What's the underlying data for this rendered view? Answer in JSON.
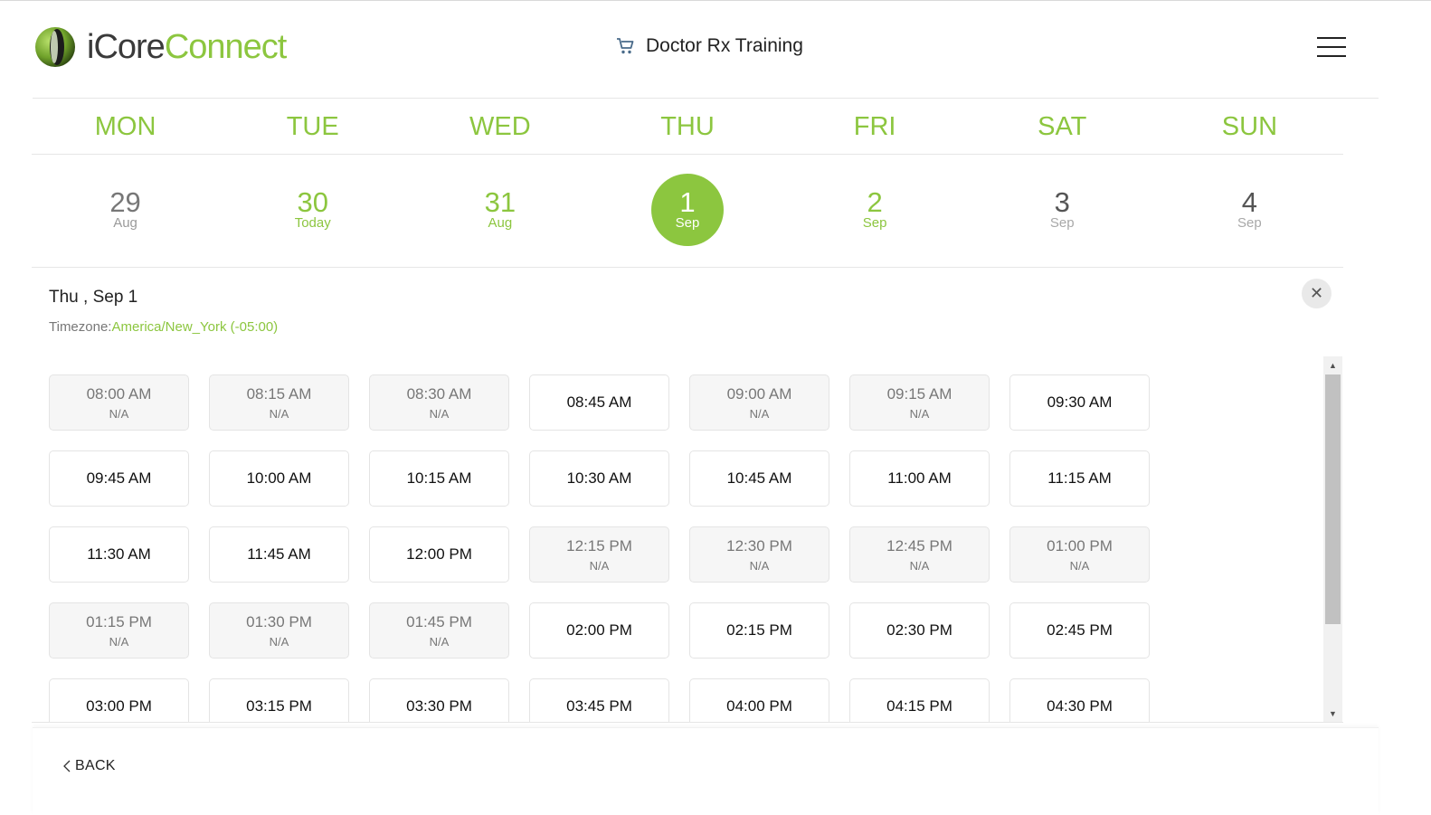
{
  "brand": {
    "name_part1": "iCore",
    "name_part2": "Connect",
    "green": "#8cc63f"
  },
  "header": {
    "title": "Doctor Rx Training",
    "cart_icon": "cart-icon",
    "menu_icon": "hamburger-icon"
  },
  "week": {
    "days": [
      "MON",
      "TUE",
      "WED",
      "THU",
      "FRI",
      "SAT",
      "SUN"
    ],
    "dates": [
      {
        "num": "29",
        "sub": "Aug",
        "state": "past"
      },
      {
        "num": "30",
        "sub": "Today",
        "state": "green"
      },
      {
        "num": "31",
        "sub": "Aug",
        "state": "green"
      },
      {
        "num": "1",
        "sub": "Sep",
        "state": "selected"
      },
      {
        "num": "2",
        "sub": "Sep",
        "state": "green"
      },
      {
        "num": "3",
        "sub": "Sep",
        "state": "weekend"
      },
      {
        "num": "4",
        "sub": "Sep",
        "state": "weekend"
      }
    ]
  },
  "details": {
    "title": "Thu , Sep 1",
    "timezone_label": "Timezone:",
    "timezone_value": "America/New_York (-05:00)",
    "close_icon": "close-icon"
  },
  "slots": [
    [
      {
        "time": "08:00 AM",
        "status": "N/A"
      },
      {
        "time": "08:15 AM",
        "status": "N/A"
      },
      {
        "time": "08:30 AM",
        "status": "N/A"
      },
      {
        "time": "08:45 AM",
        "status": ""
      },
      {
        "time": "09:00 AM",
        "status": "N/A"
      },
      {
        "time": "09:15 AM",
        "status": "N/A"
      },
      {
        "time": "09:30 AM",
        "status": ""
      }
    ],
    [
      {
        "time": "09:45 AM",
        "status": ""
      },
      {
        "time": "10:00 AM",
        "status": ""
      },
      {
        "time": "10:15 AM",
        "status": ""
      },
      {
        "time": "10:30 AM",
        "status": ""
      },
      {
        "time": "10:45 AM",
        "status": ""
      },
      {
        "time": "11:00 AM",
        "status": ""
      },
      {
        "time": "11:15 AM",
        "status": ""
      }
    ],
    [
      {
        "time": "11:30 AM",
        "status": ""
      },
      {
        "time": "11:45 AM",
        "status": ""
      },
      {
        "time": "12:00 PM",
        "status": ""
      },
      {
        "time": "12:15 PM",
        "status": "N/A"
      },
      {
        "time": "12:30 PM",
        "status": "N/A"
      },
      {
        "time": "12:45 PM",
        "status": "N/A"
      },
      {
        "time": "01:00 PM",
        "status": "N/A"
      }
    ],
    [
      {
        "time": "01:15 PM",
        "status": "N/A"
      },
      {
        "time": "01:30 PM",
        "status": "N/A"
      },
      {
        "time": "01:45 PM",
        "status": "N/A"
      },
      {
        "time": "02:00 PM",
        "status": ""
      },
      {
        "time": "02:15 PM",
        "status": ""
      },
      {
        "time": "02:30 PM",
        "status": ""
      },
      {
        "time": "02:45 PM",
        "status": ""
      }
    ],
    [
      {
        "time": "03:00 PM",
        "status": ""
      },
      {
        "time": "03:15 PM",
        "status": ""
      },
      {
        "time": "03:30 PM",
        "status": ""
      },
      {
        "time": "03:45 PM",
        "status": ""
      },
      {
        "time": "04:00 PM",
        "status": ""
      },
      {
        "time": "04:15 PM",
        "status": ""
      },
      {
        "time": "04:30 PM",
        "status": ""
      }
    ]
  ],
  "footer": {
    "back_label": "BACK",
    "back_icon": "chevron-left-icon"
  }
}
